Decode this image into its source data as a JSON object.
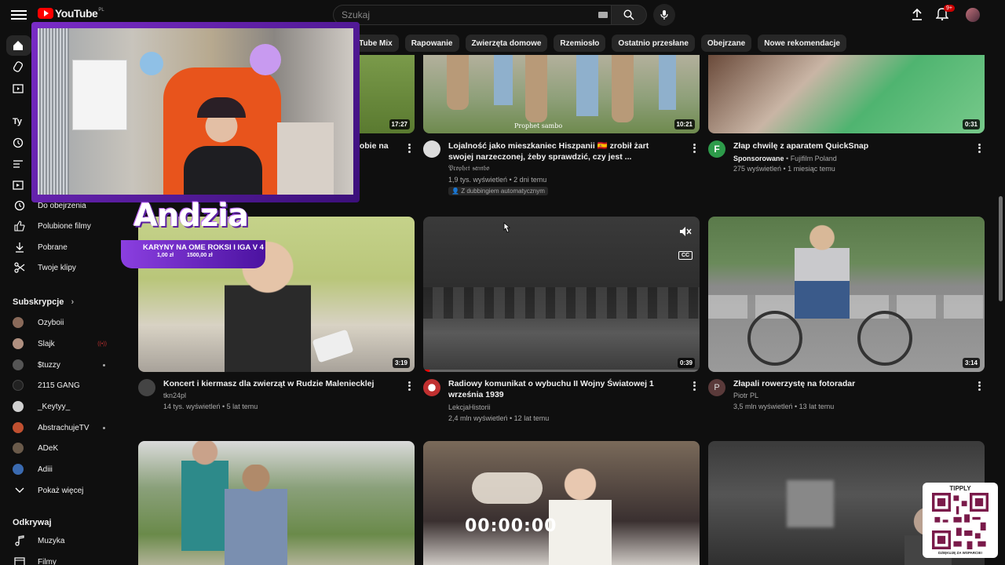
{
  "header": {
    "logo_text": "YouTube",
    "logo_country": "PL",
    "search_placeholder": "Szukaj",
    "notifications_badge": "9+"
  },
  "chips": [
    "uTube Mix",
    "Rapowanie",
    "Zwierzęta domowe",
    "Rzemiosło",
    "Ostatnio przesłane",
    "Obejrzane",
    "Nowe rekomendacje"
  ],
  "sidebar": {
    "section_you": "Ty",
    "items": [
      {
        "label": "Do obejrzenia",
        "icon": "clock-icon"
      },
      {
        "label": "Polubione filmy",
        "icon": "thumb-up-icon"
      },
      {
        "label": "Pobrane",
        "icon": "download-icon"
      },
      {
        "label": "Twoje klipy",
        "icon": "scissors-icon"
      }
    ],
    "subscriptions_header": "Subskrypcje",
    "subscriptions": [
      {
        "name": "Ozyboii",
        "color": "#8a6a5a"
      },
      {
        "name": "Slajk",
        "color": "#b09080"
      },
      {
        "name": "$tuzzy",
        "color": "#555555"
      },
      {
        "name": "2115 GANG",
        "color": "#222222"
      },
      {
        "name": "_Keytyy_",
        "color": "#d0d0d0"
      },
      {
        "name": "AbstrachujeTV",
        "color": "#c05030"
      },
      {
        "name": "ADeK",
        "color": "#6a5a4a"
      },
      {
        "name": "Adiii",
        "color": "#3a6ab0"
      }
    ],
    "show_more": "Pokaż więcej",
    "explore_header": "Odkrywaj",
    "explore": [
      {
        "label": "Muzyka",
        "icon": "music-icon"
      },
      {
        "label": "Filmy",
        "icon": "film-icon"
      }
    ]
  },
  "videos_row1": [
    {
      "title": "sobie na",
      "duration": "17:27"
    },
    {
      "title": "Lojalność jako mieszkaniec Hiszpanii 🇪🇸 zrobił żart swojej narzeczonej, żeby sprawdzić, czy jest ...",
      "channel": "𝔓𝔯𝔬𝔭𝔥𝔢𝔱 𝔰𝔞𝔪𝔟𝔬",
      "meta": "1,9 tys. wyświetleń • 2 dni temu",
      "badge": "Z dubbingiem automatycznym",
      "duration": "10:21",
      "thumb_watermark": "Prophet sambo"
    },
    {
      "title": "Złap chwilę z aparatem QuickSnap",
      "sponsored": "Sponsorowane",
      "channel": "Fujifilm Poland",
      "meta": "275 wyświetleń • 1 miesiąc temu",
      "duration": "0:31",
      "avatar_letter": "F"
    }
  ],
  "videos_row2": [
    {
      "title": "Koncert i kiermasz dla zwierząt w Rudzie Maleniecklej",
      "channel": "tkn24pl",
      "meta": "14 tys. wyświetleń • 5 lat temu",
      "duration": "3:19"
    },
    {
      "title": "Radiowy komunikat o wybuchu II Wojny Światowej 1 września 1939",
      "channel": "LekcjaHistorii",
      "meta": "2,4 mln wyświetleń • 12 lat temu",
      "duration": "0:39",
      "cc": "CC"
    },
    {
      "title": "Złapali rowerzystę na fotoradar",
      "channel": "Piotr PL",
      "meta": "3,5 mln wyświetleń • 13 lat temu",
      "duration": "3:14",
      "avatar_letter": "P"
    }
  ],
  "overlay": {
    "streamer_name": "Andzia",
    "goal_title": "KARYNY NA OME ROKSI I IGA V 4",
    "goal_current": "1,00 zł",
    "goal_target": "1500,00 zł",
    "timer": "00:00:00",
    "tipply_title": "TIPPLY",
    "tipply_subtitle": "DZIĘKUJĘ ZA WSPARCIE!"
  },
  "colors": {
    "background": "#0f0f0f",
    "chip": "#272727",
    "brand_red": "#ff0000",
    "overlay_purple": "#7a2cc7"
  }
}
